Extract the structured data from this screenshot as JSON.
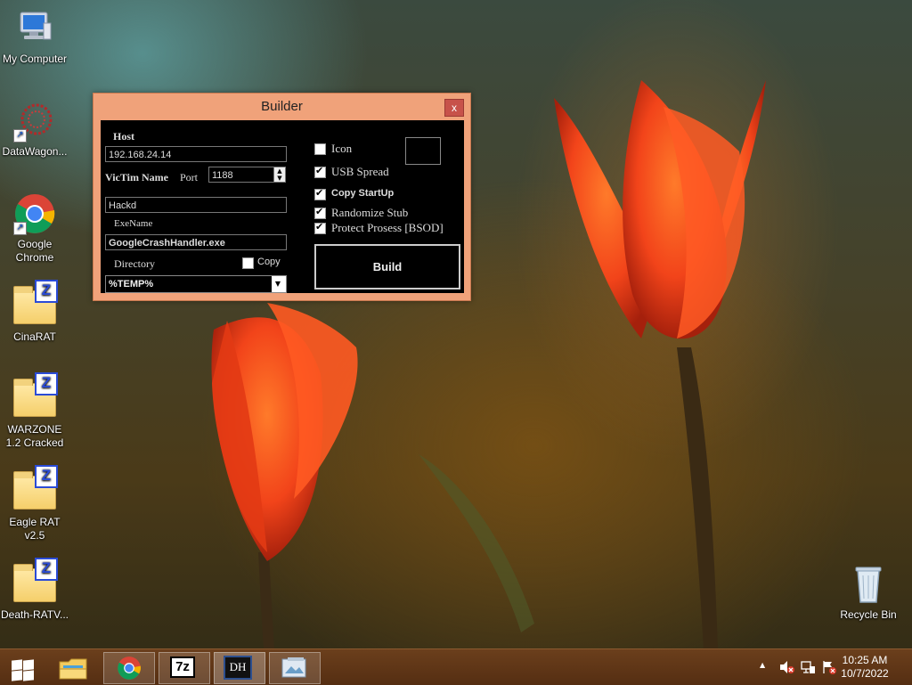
{
  "desktop": {
    "icons": [
      {
        "label": "My Computer",
        "icon": "computer-icon"
      },
      {
        "label": "DataWagon...",
        "icon": "datawagon-icon"
      },
      {
        "label": "Google Chrome",
        "icon": "chrome-icon"
      },
      {
        "label": "CinaRAT",
        "icon": "winrar-folder-icon"
      },
      {
        "label": "WARZONE 1.2 Cracked",
        "icon": "winrar-folder-icon"
      },
      {
        "label": "Eagle RAT v2.5",
        "icon": "winrar-folder-icon"
      },
      {
        "label": "Death-RATV...",
        "icon": "winrar-folder-icon"
      },
      {
        "label": "Recycle Bin",
        "icon": "recycle-bin-icon"
      }
    ]
  },
  "builder": {
    "title": "Builder",
    "close_glyph": "x",
    "host_label": "Host",
    "host_value": "192.168.24.14",
    "victim_name_label": "VicTim Name",
    "port_label": "Port",
    "port_value": "1188",
    "victim_name_value": "Hackd",
    "exe_name_label": "ExeName",
    "exe_name_value": "GoogleCrashHandler.exe",
    "directory_label": "Directory",
    "copy_label": "Copy",
    "copy_checked": false,
    "directory_value": "%TEMP%",
    "options": {
      "icon": {
        "label": "Icon",
        "checked": false
      },
      "usb_spread": {
        "label": "USB Spread",
        "checked": true
      },
      "copy_startup": {
        "label": "Copy StartUp",
        "checked": true
      },
      "randomize_stub": {
        "label": "Randomize Stub",
        "checked": true
      },
      "protect_process": {
        "label": "Protect Prosess [BSOD]",
        "checked": true
      }
    },
    "build_label": "Build"
  },
  "taskbar": {
    "items": [
      {
        "name": "start",
        "icon": "windows-logo-icon"
      },
      {
        "name": "file-explorer",
        "icon": "folder-icon"
      },
      {
        "name": "chrome",
        "icon": "chrome-icon"
      },
      {
        "name": "7zip",
        "icon": "7zip-icon",
        "text": "7z"
      },
      {
        "name": "dh-builder",
        "icon": "dh-icon",
        "text": "DH"
      },
      {
        "name": "screenshot-tool",
        "icon": "image-viewer-icon"
      }
    ],
    "clock": {
      "time": "10:25 AM",
      "date": "10/7/2022"
    },
    "tray": {
      "expand_glyph": "▲"
    }
  }
}
